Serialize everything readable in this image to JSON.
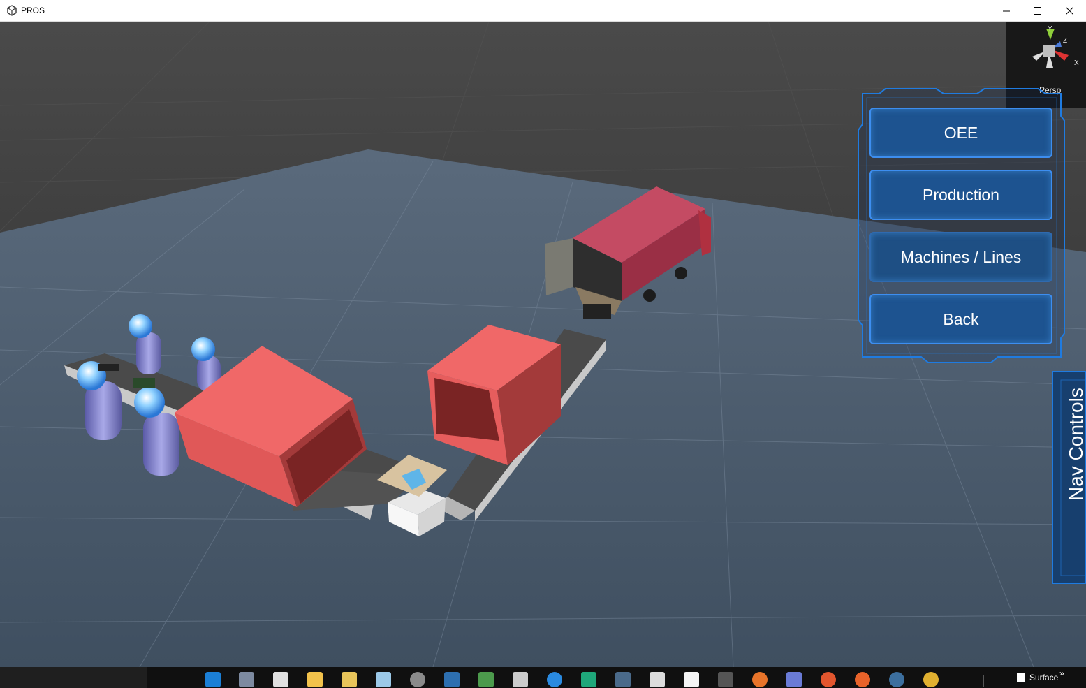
{
  "window": {
    "title": "PROS"
  },
  "viewport": {
    "projection_label": "Persp"
  },
  "gizmo": {
    "axis_y": "Y",
    "axis_z": "Z",
    "axis_x": "X"
  },
  "nav_panel": {
    "buttons": [
      {
        "label": "OEE"
      },
      {
        "label": "Production"
      },
      {
        "label": "Machines / Lines"
      },
      {
        "label": "Back"
      }
    ],
    "tab_label": "Nav Controls"
  },
  "taskbar": {
    "pinned": [
      "edge-icon",
      "gecko-icon",
      "store-icon",
      "file-explorer-icon",
      "documents-icon",
      "notepad-icon",
      "media-player-icon",
      "s-app-icon",
      "photo-app-icon",
      "unity-icon",
      "internet-explorer-icon",
      "selenium-icon",
      "pocket-icon",
      "re-app-icon",
      "file-icon",
      "inkscape-icon",
      "firefox-icon",
      "discord-icon",
      "tool-icon",
      "firefox-dev-icon",
      "tree-app-icon",
      "chrome-icon"
    ],
    "tray_label": "Surface"
  },
  "colors": {
    "floor": "#4b5b6d",
    "sky": "#3a3a3a",
    "panel_frame": "#1f7be0",
    "button_fill": "#1d5390",
    "box_red": "#f16262"
  }
}
